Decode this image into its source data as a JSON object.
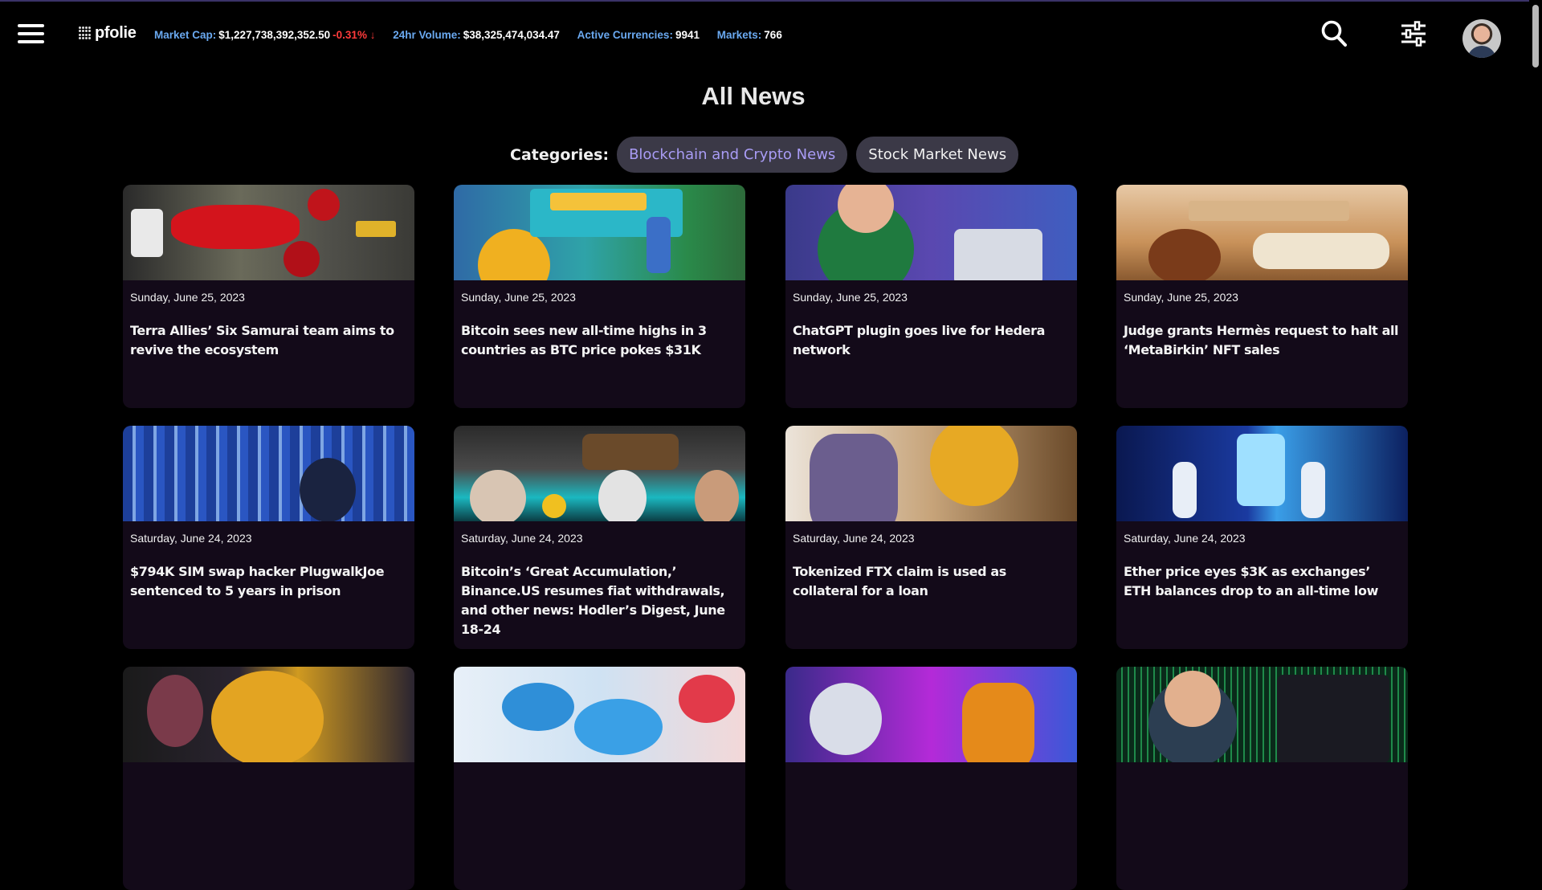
{
  "header": {
    "logo_text": "pfolie",
    "stats": {
      "market_cap_label": "Market Cap:",
      "market_cap_value": "$1,227,738,392,352.50",
      "market_cap_change": "-0.31% ↓",
      "volume_label": "24hr Volume:",
      "volume_value": "$38,325,474,034.47",
      "currencies_label": "Active Currencies:",
      "currencies_value": "9941",
      "markets_label": "Markets:",
      "markets_value": "766"
    }
  },
  "page": {
    "title": "All News",
    "categories_label": "Categories:",
    "categories": [
      "Blockchain and Crypto News",
      "Stock Market News"
    ],
    "active_category": "Blockchain and Crypto News"
  },
  "colors": {
    "accent_label": "#6aa9f0",
    "negative": "#ff3b3b",
    "chip_active_text": "#a99cf5",
    "card_bg": "#130a19"
  },
  "news": [
    {
      "date": "Sunday, June 25, 2023",
      "title": "Terra Allies’ Six Samurai team aims to revive the ecosystem"
    },
    {
      "date": "Sunday, June 25, 2023",
      "title": "Bitcoin sees new all-time highs in 3 countries as BTC price pokes $31K"
    },
    {
      "date": "Sunday, June 25, 2023",
      "title": "ChatGPT plugin goes live for Hedera network"
    },
    {
      "date": "Sunday, June 25, 2023",
      "title": "Judge grants Hermès request to halt all ‘MetaBirkin’ NFT sales"
    },
    {
      "date": "Saturday, June 24, 2023",
      "title": "$794K SIM swap hacker PlugwalkJoe sentenced to 5 years in prison"
    },
    {
      "date": "Saturday, June 24, 2023",
      "title": "Bitcoin’s ‘Great Accumulation,’ Binance.US resumes fiat withdrawals, and other news: Hodler’s Digest, June 18-24"
    },
    {
      "date": "Saturday, June 24, 2023",
      "title": "Tokenized FTX claim is used as collateral for a loan"
    },
    {
      "date": "Saturday, June 24, 2023",
      "title": "Ether price eyes $3K as exchanges’ ETH balances drop to an all-time low"
    },
    {
      "date": "",
      "title": ""
    },
    {
      "date": "",
      "title": ""
    },
    {
      "date": "",
      "title": ""
    },
    {
      "date": "",
      "title": ""
    }
  ]
}
